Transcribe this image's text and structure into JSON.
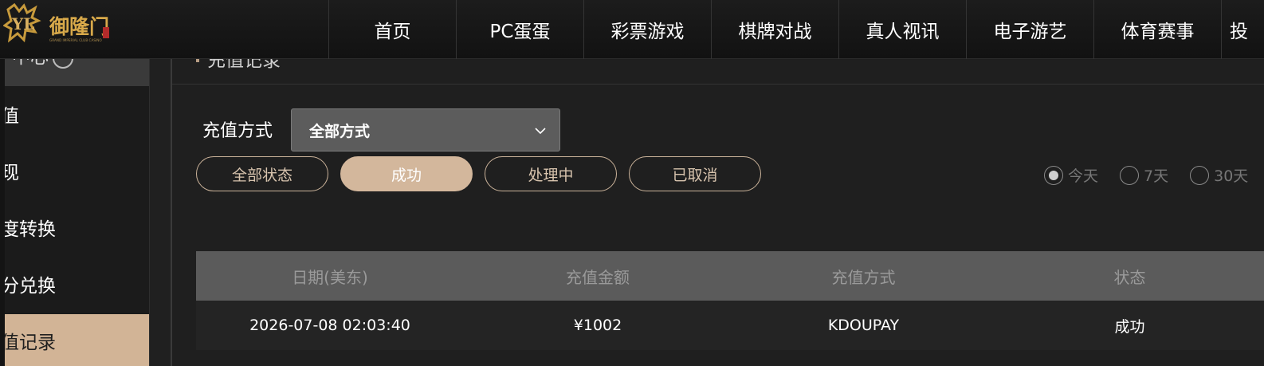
{
  "brand": {
    "name": "御隆门",
    "tagline": "GRAND IMPERIAL CLUB CASINO",
    "gold": "#c79a3c"
  },
  "nav": {
    "items": [
      "首页",
      "PC蛋蛋",
      "彩票游戏",
      "棋牌对战",
      "真人视讯",
      "电子游艺",
      "体育赛事"
    ],
    "partial": "投"
  },
  "sidebar": {
    "head": "个中心",
    "items": [
      {
        "label": "充值",
        "active": false
      },
      {
        "label": "提现",
        "active": false
      },
      {
        "label": "额度转换",
        "active": false
      },
      {
        "label": "积分兑换",
        "active": false
      },
      {
        "label": "充值记录",
        "active": true
      }
    ]
  },
  "content": {
    "title": "充值记录",
    "method_label": "充值方式",
    "method_value": "全部方式",
    "status_filters": [
      {
        "label": "全部状态",
        "active": false
      },
      {
        "label": "成功",
        "active": true
      },
      {
        "label": "处理中",
        "active": false
      },
      {
        "label": "已取消",
        "active": false
      }
    ],
    "date_ranges": [
      {
        "label": "今天",
        "checked": true
      },
      {
        "label": "7天",
        "checked": false
      },
      {
        "label": "30天",
        "checked": false
      }
    ],
    "table": {
      "columns": [
        "日期(美东)",
        "充值金额",
        "充值方式",
        "状态"
      ],
      "rows": [
        [
          "2026-07-08 02:03:40",
          "¥1002",
          "KDOUPAY",
          "成功"
        ]
      ]
    }
  },
  "colors": {
    "accent": "#d3b79c",
    "background": "#1f1f1f",
    "header_row": "#5b5b5b"
  }
}
